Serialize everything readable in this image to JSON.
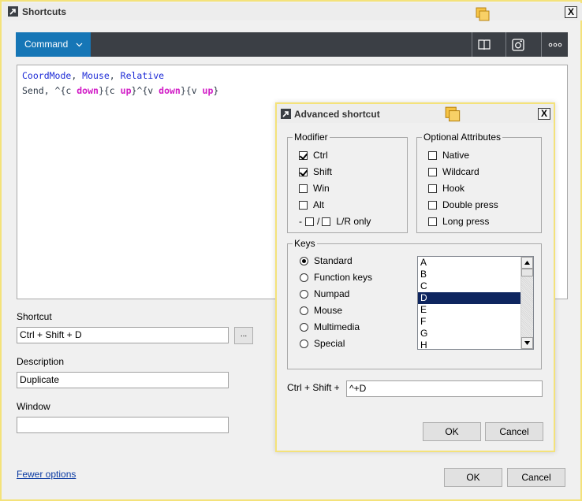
{
  "window": {
    "title": "Shortcuts",
    "close_label": "X"
  },
  "toolbar": {
    "command_label": "Command",
    "icons": [
      "book-icon",
      "snapshot-icon",
      "more-icon"
    ]
  },
  "editor": {
    "line1": {
      "a": "CoordMode",
      "b": ", ",
      "c": "Mouse",
      "d": ", ",
      "e": "Relative"
    },
    "line2": {
      "a": "Send, ^{c ",
      "b": "down",
      "c": "}{c ",
      "d": "up",
      "e": "}^{v ",
      "f": "down",
      "g": "}{v ",
      "h": "up",
      "i": "}"
    }
  },
  "form": {
    "shortcut_label": "Shortcut",
    "shortcut_value": "Ctrl + Shift + D",
    "browse_label": "...",
    "description_label": "Description",
    "description_value": "Duplicate",
    "window_label": "Window",
    "window_value": "",
    "fewer_options": "Fewer options",
    "ok": "OK",
    "cancel": "Cancel"
  },
  "dialog": {
    "title": "Advanced shortcut",
    "close_label": "X",
    "modifier": {
      "legend": "Modifier",
      "ctrl": "Ctrl",
      "shift": "Shift",
      "win": "Win",
      "alt": "Alt",
      "lr_dash": "-",
      "lr_slash": "/",
      "lr_only": "L/R only"
    },
    "optional": {
      "legend": "Optional Attributes",
      "native": "Native",
      "wildcard": "Wildcard",
      "hook": "Hook",
      "double_press": "Double press",
      "long_press": "Long press"
    },
    "keys": {
      "legend": "Keys",
      "standard": "Standard",
      "function_keys": "Function keys",
      "numpad": "Numpad",
      "mouse": "Mouse",
      "multimedia": "Multimedia",
      "special": "Special",
      "list": [
        "A",
        "B",
        "C",
        "D",
        "E",
        "F",
        "G",
        "H"
      ],
      "selected": "D"
    },
    "combo_label": "Ctrl + Shift +",
    "combo_value": "^+D",
    "ok": "OK",
    "cancel": "Cancel"
  },
  "colors": {
    "accent": "#1676b6",
    "toolbar": "#3b3f45",
    "border_highlight": "#f4e27a",
    "selection": "#0e255f",
    "keyword_blue": "#1d2bd6",
    "keyword_pink": "#d11bc6"
  }
}
